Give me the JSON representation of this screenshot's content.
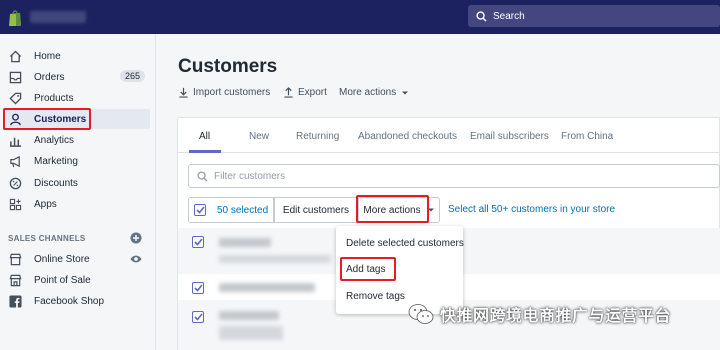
{
  "topbar": {
    "search_label": "Search"
  },
  "sidebar": {
    "items": [
      {
        "label": "Home"
      },
      {
        "label": "Orders",
        "badge": "265"
      },
      {
        "label": "Products"
      },
      {
        "label": "Customers"
      },
      {
        "label": "Analytics"
      },
      {
        "label": "Marketing"
      },
      {
        "label": "Discounts"
      },
      {
        "label": "Apps"
      }
    ],
    "sales_channels_title": "SALES CHANNELS",
    "channels": [
      {
        "label": "Online Store"
      },
      {
        "label": "Point of Sale"
      },
      {
        "label": "Facebook Shop"
      }
    ]
  },
  "main": {
    "title": "Customers",
    "actions": {
      "import": "Import customers",
      "export": "Export",
      "more": "More actions"
    },
    "tabs": [
      "All",
      "New",
      "Returning",
      "Abandoned checkouts",
      "Email subscribers",
      "From China"
    ],
    "filter_placeholder": "Filter customers",
    "bulk": {
      "selected": "50 selected",
      "edit": "Edit customers",
      "more": "More actions",
      "select_all": "Select all 50+ customers in your store"
    },
    "dropdown": [
      "Delete selected customers",
      "Add tags",
      "Remove tags"
    ]
  },
  "watermark": {
    "text": "快推网跨境电商推广与运营平台"
  },
  "colors": {
    "topbar": "#1c2260",
    "accent": "#5c6ac4",
    "highlight": "#e51c23",
    "link": "#006fbb"
  }
}
